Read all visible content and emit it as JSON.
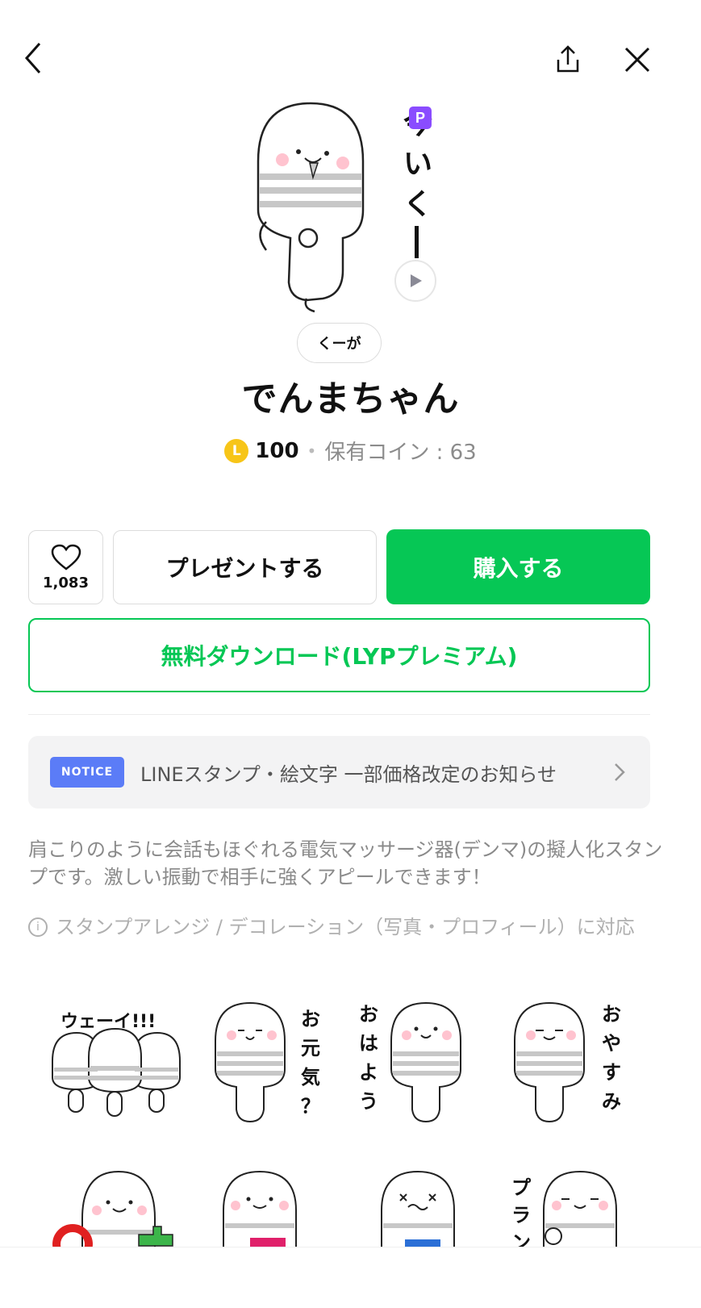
{
  "header": {
    "back_icon": "chevron-left-icon",
    "share_icon": "share-icon",
    "close_icon": "close-icon"
  },
  "hero": {
    "premium_badge": "P",
    "sticker_text": "今いくー",
    "play_icon": "play-icon"
  },
  "product": {
    "author": "くーが",
    "title": "でんまちゃん",
    "coin_symbol": "L",
    "price": "100",
    "separator": "•",
    "owned_coins": "保有コイン : 63"
  },
  "actions": {
    "like_count": "1,083",
    "present_label": "プレゼントする",
    "buy_label": "購入する",
    "free_download_label": "無料ダウンロード(LYPプレミアム)"
  },
  "notice": {
    "tag": "NOTICE",
    "text": "LINEスタンプ・絵文字 一部価格改定のお知らせ"
  },
  "description": "肩こりのように会話もほぐれる電気マッサージ器(デンマ)の擬人化スタンプです。激しい振動で相手に強くアピールできます！",
  "info": {
    "icon": "i",
    "text": "スタンプアレンジ / デコレーション（写真・プロフィール）に対応"
  },
  "stickers": [
    {
      "text": "ウェーイ!!!"
    },
    {
      "text": "お元気？"
    },
    {
      "text": "おはよう"
    },
    {
      "text": "おやすみ"
    },
    {
      "text": ""
    },
    {
      "text": ""
    },
    {
      "text": ""
    },
    {
      "text": "プラン"
    }
  ],
  "colors": {
    "accent": "#06c755",
    "notice": "#5b7cf7",
    "coin": "#f7c518",
    "premium": "#8a4cff"
  }
}
